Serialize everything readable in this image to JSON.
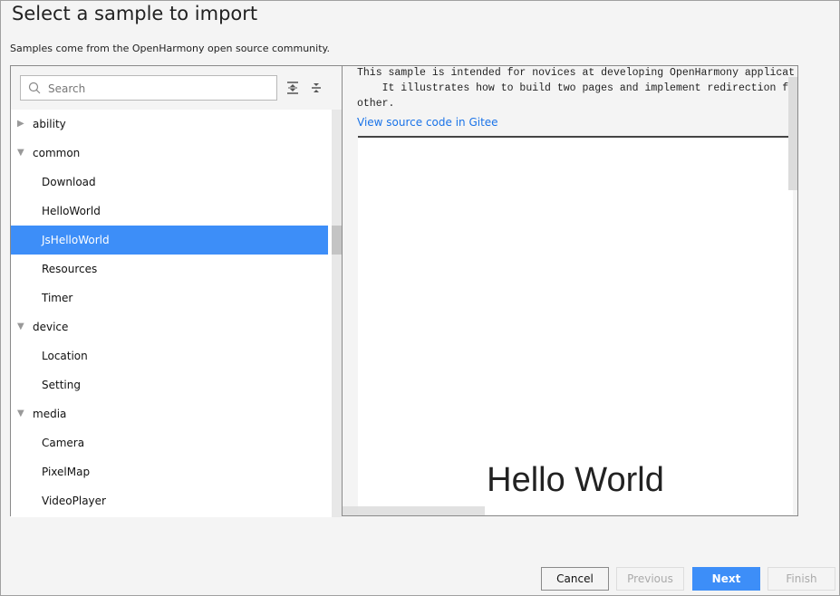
{
  "title": "Select a sample to import",
  "subtitle": "Samples come from the OpenHarmony open source community.",
  "search": {
    "placeholder": "Search"
  },
  "toolbar": {
    "expand_all": "expand-all-icon",
    "collapse_all": "collapse-all-icon"
  },
  "tree": [
    {
      "label": "ability",
      "level": 0,
      "expanded": false
    },
    {
      "label": "common",
      "level": 0,
      "expanded": true
    },
    {
      "label": "Download",
      "level": 1
    },
    {
      "label": "HelloWorld",
      "level": 1
    },
    {
      "label": "JsHelloWorld",
      "level": 1,
      "selected": true
    },
    {
      "label": "Resources",
      "level": 1
    },
    {
      "label": "Timer",
      "level": 1
    },
    {
      "label": "device",
      "level": 0,
      "expanded": true
    },
    {
      "label": "Location",
      "level": 1
    },
    {
      "label": "Setting",
      "level": 1
    },
    {
      "label": "media",
      "level": 0,
      "expanded": true
    },
    {
      "label": "Camera",
      "level": 1
    },
    {
      "label": "PixelMap",
      "level": 1
    },
    {
      "label": "VideoPlayer",
      "level": 1
    }
  ],
  "detail": {
    "lines": [
      "This sample is intended for novices at developing OpenHarmony applicat",
      "    It illustrates how to build two pages and implement redirection fr",
      "other."
    ],
    "link": "View source code in Gitee",
    "preview_text": "Hello World"
  },
  "buttons": {
    "cancel": "Cancel",
    "previous": "Previous",
    "next": "Next",
    "finish": "Finish"
  },
  "colors": {
    "accent": "#3d8ef8",
    "link": "#1a73e8"
  }
}
